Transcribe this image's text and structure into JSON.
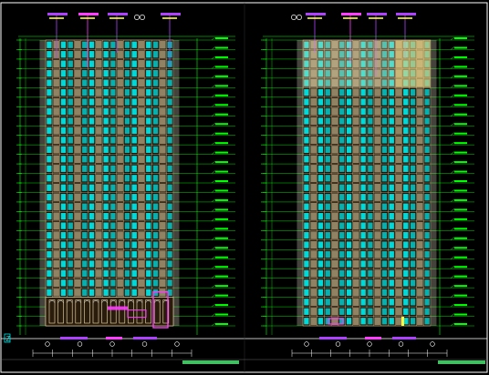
{
  "drawing": {
    "background": "#000000",
    "colors": {
      "frame": "#FFFFFF",
      "level_line": "#00FF00",
      "window_glass": "#00E5E5",
      "facade_grid": "#C8A070",
      "facade_light": "#F0E0B0",
      "annotation_pink": "#FF3CFF",
      "annotation_purple": "#B040FF",
      "annotation_yellow": "#FFFF40",
      "ground_bar": "#40C060",
      "white_text": "#FFFFFF"
    },
    "elevations": [
      {
        "id": "left",
        "floor_count": 30,
        "has_podium": true
      },
      {
        "id": "right",
        "floor_count": 30,
        "has_crown": true
      }
    ],
    "corner_mark": "Z"
  }
}
